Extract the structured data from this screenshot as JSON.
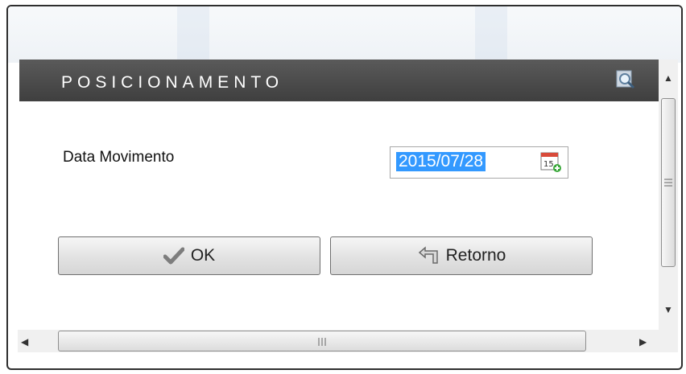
{
  "panel": {
    "title": "POSICIONAMENTO"
  },
  "form": {
    "date_label": "Data Movimento",
    "date_value": "2015/07/28"
  },
  "buttons": {
    "ok_label": "OK",
    "return_label": "Retorno"
  },
  "icons": {
    "search": "search-icon",
    "calendar": "calendar-icon",
    "ok": "checkmark-icon",
    "return": "return-arrow-icon"
  },
  "colors": {
    "header": "#4a4a4a",
    "selection": "#3399ff"
  }
}
